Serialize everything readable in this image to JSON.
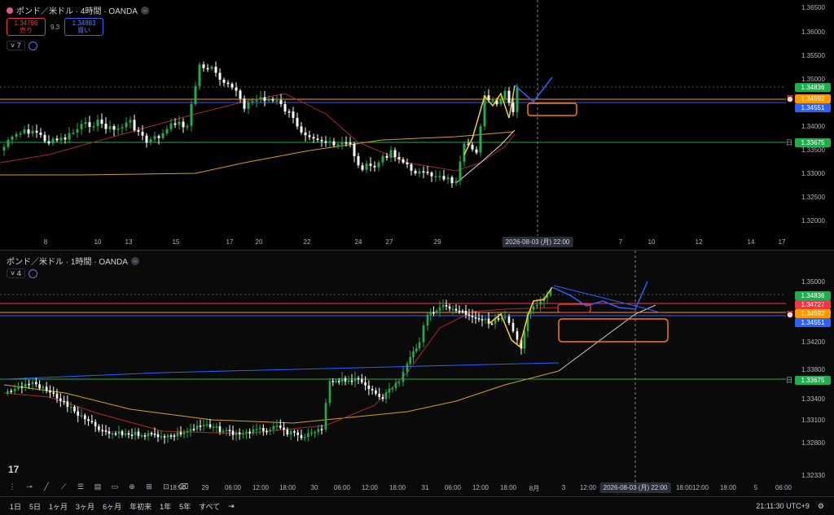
{
  "pane1": {
    "symbol": "ポンド／米ドル · 4時間 · OANDA",
    "sell_price": "1.34796",
    "sell_label": "売り",
    "spread": "9.3",
    "buy_price": "1.34883",
    "buy_label": "買い",
    "indicator_count": "7",
    "price_axis": [
      "1.36500",
      "1.36000",
      "1.35500",
      "1.35000",
      "1.34500",
      "1.34000",
      "1.33500",
      "1.33000",
      "1.32500",
      "1.32000"
    ],
    "time_axis": [
      "8",
      "10",
      "13",
      "15",
      "17",
      "20",
      "22",
      "24",
      "27",
      "29",
      "7",
      "10",
      "12",
      "14",
      "17"
    ],
    "crosshair_time": "2026-08-03 (月)  22:00",
    "tags": [
      {
        "value": "1.34836",
        "color": "#22ab4f"
      },
      {
        "value": "1.34592",
        "color": "#ff9800"
      },
      {
        "value": "1.34551",
        "color": "#2962ff"
      },
      {
        "value": "1.33675",
        "color": "#22ab4f"
      }
    ],
    "side_icon": "日"
  },
  "pane2": {
    "symbol": "ポンド／米ドル · 1時間 · OANDA",
    "indicator_count": "4",
    "price_axis": [
      "1.35000",
      "1.34600",
      "1.34200",
      "1.33800",
      "1.33400",
      "1.33100",
      "1.32800",
      "1.32330"
    ],
    "time_axis": [
      "18:00",
      "29",
      "06:00",
      "12:00",
      "18:00",
      "30",
      "06:00",
      "12:00",
      "18:00",
      "31",
      "06:00",
      "12:00",
      "18:00",
      "8月",
      "3",
      "12:00",
      "18:00",
      "12:00",
      "18:00",
      "5",
      "06:00"
    ],
    "crosshair_time": "2026-08-03 (月)  22:00",
    "tags": [
      {
        "value": "1.34836",
        "color": "#22ab4f"
      },
      {
        "value": "1.34727",
        "color": "#f23645"
      },
      {
        "value": "1.34592",
        "color": "#ff9800"
      },
      {
        "value": "1.34551",
        "color": "#2962ff"
      },
      {
        "value": "1.33675",
        "color": "#22ab4f"
      }
    ],
    "side_icon": "日"
  },
  "bottombar": {
    "ranges": [
      "1日",
      "5日",
      "1ヶ月",
      "3ヶ月",
      "6ヶ月",
      "年初来",
      "1年",
      "5年",
      "すべて"
    ],
    "clock": "21:11:30 UTC+9"
  },
  "colors": {
    "up": "#22ab4f",
    "down": "#ffffff",
    "accent": "#2962ff"
  }
}
